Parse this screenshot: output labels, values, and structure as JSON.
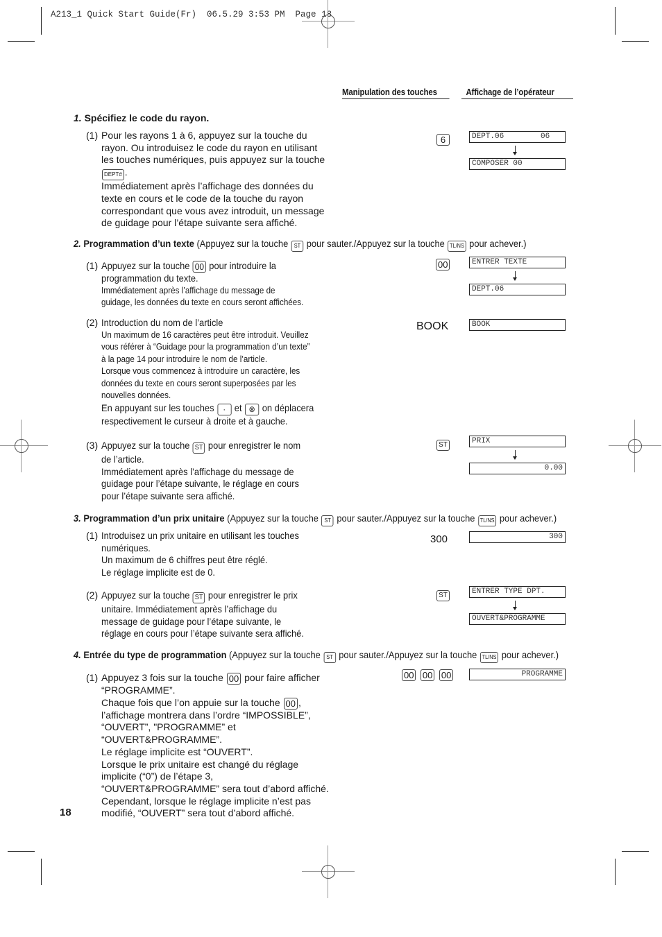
{
  "slug": "A213_1 Quick Start Guide(Fr)  06.5.29 3:53 PM  Page 18",
  "columns": {
    "keys": "Manipulation des touches",
    "display": "Affichage de l’opérateur"
  },
  "keys": {
    "dept": "DEPT#",
    "st": "ST",
    "tlns": "TL/NS",
    "dbl_zero": "00",
    "six": "6",
    "dot": "·",
    "otimes": "⊗"
  },
  "steps": [
    {
      "number": "1.",
      "title": "Spécifiez le code du rayon.",
      "note": "",
      "items": [
        {
          "label": "(1)",
          "lines": [
            "Pour les rayons 1 à 6, appuyez sur la touche du",
            "rayon. Ou introduisez le code du rayon en utilisant",
            "les touches numériques, puis appuyez sur la touche"
          ],
          "after_key": ".",
          "lines2": [
            "Immédiatement après l’affichage des données du",
            "texte en cours et le code de la touche du rayon",
            "correspondant que vous avez introduit, un message",
            "de guidage pour l’étape suivante sera affiché."
          ],
          "key_input": "6",
          "displays": [
            "DEPT.06        06",
            "COMPOSER 00"
          ]
        }
      ]
    },
    {
      "number": "2.",
      "title": "Programmation d’un texte",
      "note_pre": "(Appuyez sur la touche",
      "note_mid": "pour sauter./Appuyez sur la touche",
      "note_post": "pour achever.)",
      "items": [
        {
          "label": "(1)",
          "line1_pre": "Appuyez sur la touche",
          "line1_post": "pour introduire la",
          "line2": "programmation du texte.",
          "small": [
            "Immédiatement après l’affichage du message de",
            "guidage, les données du texte en cours seront affichées."
          ],
          "key_input": "00",
          "displays": [
            "ENTRER TEXTE",
            "DEPT.06"
          ]
        },
        {
          "label": "(2)",
          "line1": "Introduction du nom de l’article",
          "small": [
            "Un maximum de 16 caractères peut être introduit. Veuillez",
            "vous référer à “Guidage pour la programmation d’un texte”",
            "à la page 14 pour introduire le nom de l’article.",
            "Lorsque vous commencez à introduire un caractère, les",
            "données du texte en cours seront superposées par les",
            "nouvelles données."
          ],
          "cursor_pre": "En appuyant sur les touches",
          "cursor_mid": "et",
          "cursor_post": "on déplacera",
          "cursor_line2": "respectivement le curseur à droite et à gauche.",
          "key_input": "BOOK",
          "displays": [
            "BOOK"
          ]
        },
        {
          "label": "(3)",
          "line1_pre": "Appuyez sur la touche",
          "line1_post": "pour enregistrer le nom",
          "lines": [
            "de l’article.",
            "Immédiatement après l’affichage du message de",
            "guidage pour l’étape suivante, le réglage en cours",
            "pour l’étape suivante sera affiché."
          ],
          "key_input": "ST",
          "displays": [
            "PRIX",
            "0.00"
          ]
        }
      ]
    },
    {
      "number": "3.",
      "title": "Programmation d’un prix unitaire",
      "note_pre": "(Appuyez sur la touche",
      "note_mid": "pour sauter./Appuyez sur la touche",
      "note_post": "pour achever.)",
      "items": [
        {
          "label": "(1)",
          "lines": [
            "Introduisez un prix unitaire en utilisant les touches",
            "numériques.",
            "Un maximum de 6 chiffres peut être réglé.",
            "Le réglage implicite est de 0."
          ],
          "key_input": "300",
          "displays": [
            "300"
          ]
        },
        {
          "label": "(2)",
          "line1_pre": "Appuyez sur la touche",
          "line1_post": "pour enregistrer le prix",
          "lines": [
            "unitaire. Immédiatement après l’affichage du",
            "message de guidage pour l’étape suivante, le",
            "réglage en cours pour l’étape suivante sera affiché."
          ],
          "key_input": "ST",
          "displays": [
            "ENTRER TYPE DPT.",
            "OUVERT&PROGRAMME"
          ]
        }
      ]
    },
    {
      "number": "4.",
      "title": "Entrée du type de programmation",
      "note_pre": "(Appuyez sur la touche",
      "note_mid": "pour sauter./Appuyez sur la touche",
      "note_post": "pour achever.)",
      "items": [
        {
          "label": "(1)",
          "line1_pre": "Appuyez 3 fois sur la touche",
          "line1_post": "pour faire afficher",
          "line2": "“PROGRAMME”.",
          "line3_pre": "Chaque fois que l’on appuie sur la touche",
          "line3_post": ",",
          "lines": [
            "l’affichage montrera dans l’ordre “IMPOSSIBLE”,",
            "“OUVERT”, \"PROGRAMME” et",
            "“OUVERT&PROGRAMME”.",
            "Le réglage implicite est “OUVERT”.",
            "Lorsque le prix unitaire est changé du réglage",
            "implicite (“0”) de l’étape 3,",
            "“OUVERT&PROGRAMME” sera tout d’abord affiché.",
            "Cependant, lorsque le réglage implicite n’est pas",
            "modifié, “OUVERT” sera tout d’abord affiché."
          ],
          "displays": [
            "PROGRAMME"
          ]
        }
      ]
    }
  ],
  "page_number": "18"
}
